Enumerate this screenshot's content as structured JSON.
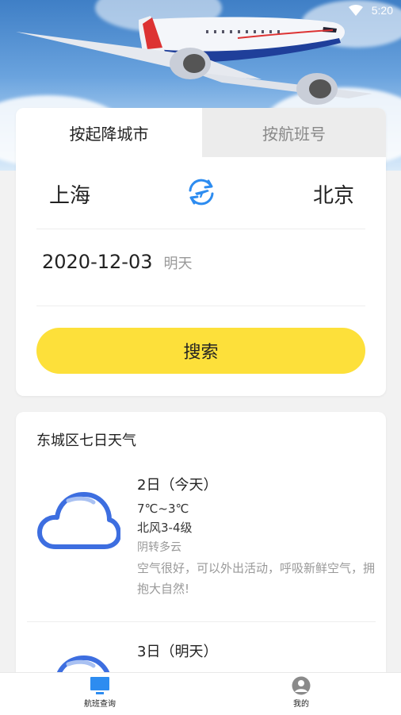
{
  "status_bar": {
    "time": "5:20"
  },
  "tabs": {
    "city": "按起降城市",
    "flight_no": "按航班号"
  },
  "route": {
    "from": "上海",
    "to": "北京"
  },
  "date": {
    "value": "2020-12-03",
    "hint": "明天"
  },
  "search": {
    "label": "搜索"
  },
  "weather": {
    "title": "东城区七日天气",
    "days": [
      {
        "date": "2日（今天）",
        "temp": "7℃~3℃",
        "wind": "北风3-4级",
        "condition": "阴转多云",
        "advice": "空气很好，可以外出活动，呼吸新鲜空气，拥抱大自然!"
      },
      {
        "date": "3日（明天）"
      }
    ]
  },
  "nav": {
    "flights": "航班查询",
    "mine": "我的"
  },
  "colors": {
    "accent": "#fde03a",
    "primary_blue": "#2d8cf0"
  }
}
